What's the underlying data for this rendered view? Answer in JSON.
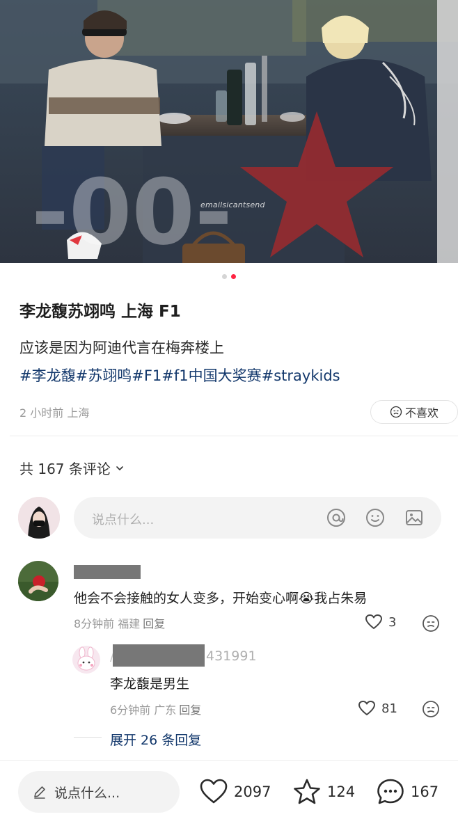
{
  "photo": {
    "watermark": "emailsicantsend",
    "carousel_count": 2,
    "carousel_active": 2
  },
  "post": {
    "title": "李龙馥苏翊鸣 上海 F1",
    "description": "应该是因为阿迪代言在梅奔楼上",
    "tags": [
      "#李龙馥",
      "#苏翊鸣",
      "#F1",
      "#f1中国大奖赛",
      "#straykids"
    ],
    "meta": "2 小时前 上海",
    "dislike_label": "不喜欢"
  },
  "comments_header": {
    "label": "共 167 条评论"
  },
  "comment_input": {
    "placeholder": "说点什么..."
  },
  "comments": [
    {
      "text": "他会不会接触的女人变多，开始变心啊😭我占朱易",
      "meta": "8分钟前 福建",
      "reply_label": "回复",
      "likes": "3",
      "replies": [
        {
          "username_suffix": "431991",
          "text": "李龙馥是男生",
          "meta": "6分钟前 广东",
          "reply_label": "回复",
          "likes": "81"
        }
      ],
      "expand_label": "展开 26 条回复"
    }
  ],
  "bottom_bar": {
    "placeholder": "说点什么...",
    "likes": "2097",
    "favorites": "124",
    "comments": "167"
  },
  "colors": {
    "accent": "#ff2442",
    "link": "#13386c",
    "muted": "#999999"
  }
}
